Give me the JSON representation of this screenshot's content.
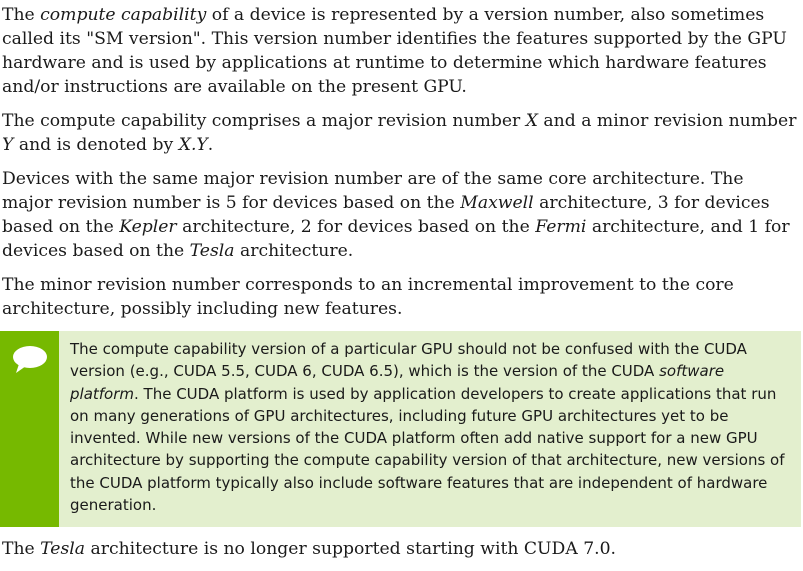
{
  "paragraph1": {
    "part1": "The ",
    "em1": "compute capability",
    "part2": " of a device is represented by a version number, also sometimes called its \"SM version\". This version number identifies the features supported by the GPU hardware and is used by applications at runtime to determine which hardware features and/or instructions are available on the present GPU."
  },
  "paragraph2": {
    "part1": "The compute capability comprises a major revision number ",
    "em1": "X",
    "part2": " and a minor revision number ",
    "em2": "Y",
    "part3": " and is denoted by ",
    "em3": "X.Y",
    "part4": "."
  },
  "paragraph3": {
    "part1": "Devices with the same major revision number are of the same core architecture. The major revision number is 5 for devices based on the ",
    "em1": "Maxwell",
    "part2": " architecture, 3 for devices based on the ",
    "em2": "Kepler",
    "part3": " architecture, 2 for devices based on the ",
    "em3": "Fermi",
    "part4": " architecture, and 1 for devices based on the ",
    "em4": "Tesla",
    "part5": " architecture."
  },
  "paragraph4": {
    "text": "The minor revision number corresponds to an incremental improvement to the core architecture, possibly including new features."
  },
  "note": {
    "icon": "speech-bubble-icon",
    "part1": "The compute capability version of a particular GPU should not be confused with the CUDA version (e.g., CUDA 5.5, CUDA 6, CUDA 6.5), which is the version of the CUDA ",
    "em1": "software platform",
    "part2": ". The CUDA platform is used by application developers to create applications that run on many generations of GPU architectures, including future GPU architectures yet to be invented. While new versions of the CUDA platform often add native support for a new GPU architecture by supporting the compute capability version of that architecture, new versions of the CUDA platform typically also include software features that are independent of hardware generation.",
    "bar_color": "#76b900",
    "bg_color": "#e3efce"
  },
  "paragraph5": {
    "part1": "The ",
    "em1": "Tesla",
    "part2": " architecture is no longer supported starting with CUDA 7.0."
  }
}
